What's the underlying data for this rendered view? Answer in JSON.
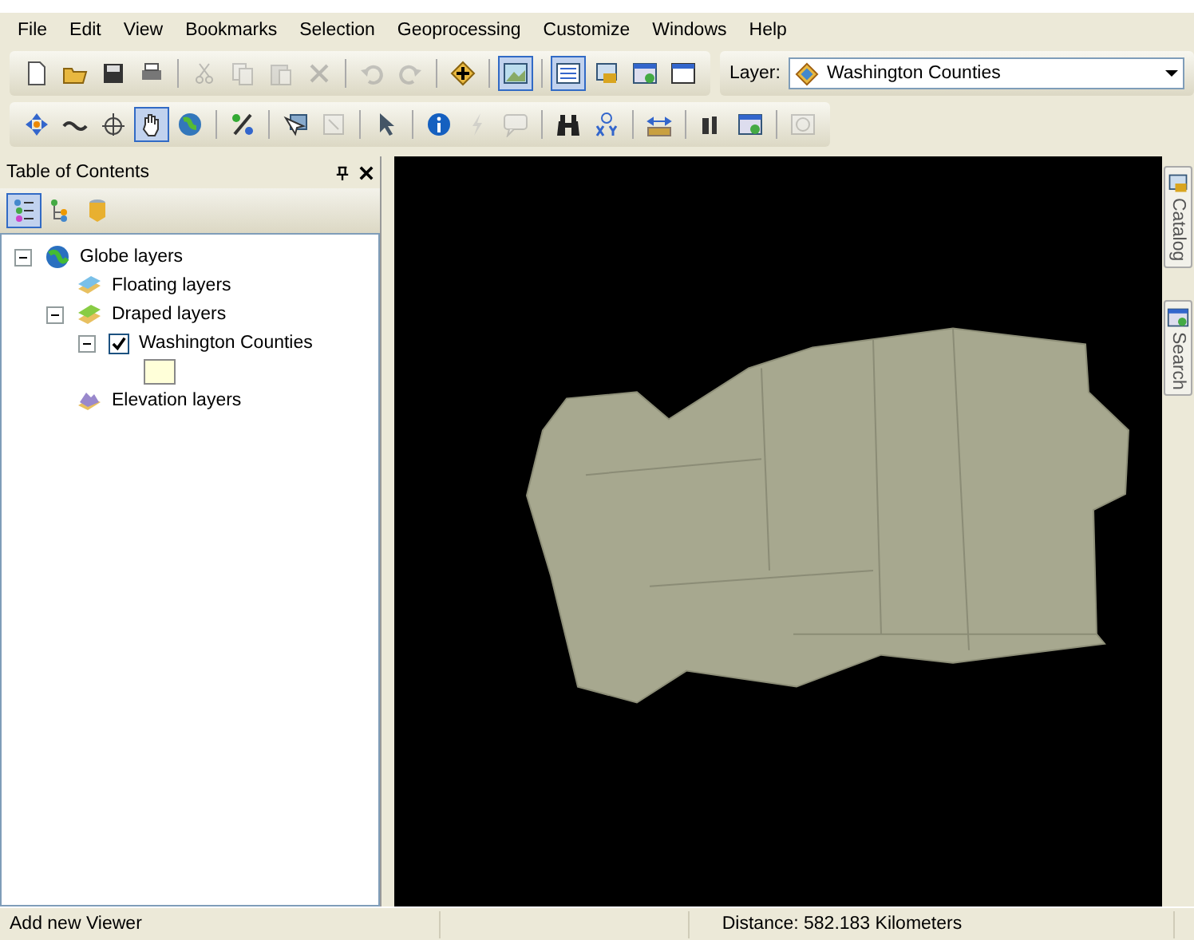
{
  "menu_bar": [
    "File",
    "Edit",
    "View",
    "Bookmarks",
    "Selection",
    "Geoprocessing",
    "Customize",
    "Windows",
    "Help"
  ],
  "toolbar_standard": [
    [
      {
        "kind": "new",
        "selected": false,
        "disabled": false
      },
      {
        "kind": "open",
        "selected": false,
        "disabled": false
      },
      {
        "kind": "save",
        "selected": false,
        "disabled": false
      },
      {
        "kind": "print",
        "selected": false,
        "disabled": false
      }
    ],
    [
      {
        "kind": "cut",
        "selected": false,
        "disabled": true
      },
      {
        "kind": "copy",
        "selected": false,
        "disabled": true
      },
      {
        "kind": "paste",
        "selected": false,
        "disabled": true
      },
      {
        "kind": "delete",
        "selected": false,
        "disabled": true
      }
    ],
    [
      {
        "kind": "undo",
        "selected": false,
        "disabled": true
      },
      {
        "kind": "redo",
        "selected": false,
        "disabled": true
      }
    ],
    [
      {
        "kind": "add",
        "selected": false,
        "disabled": false
      }
    ],
    [
      {
        "kind": "globe",
        "selected": true,
        "disabled": false
      }
    ],
    [
      {
        "kind": "list",
        "selected": true,
        "disabled": false
      },
      {
        "kind": "catalog",
        "selected": false,
        "disabled": false
      },
      {
        "kind": "window",
        "selected": false,
        "disabled": false
      },
      {
        "kind": "console",
        "selected": false,
        "disabled": false
      }
    ]
  ],
  "layer_selector": {
    "label": "Layer:",
    "value": "Washington Counties"
  },
  "toolbar_tools": [
    [
      {
        "kind": "navigate",
        "selected": false,
        "disabled": false
      },
      {
        "kind": "fly",
        "selected": false,
        "disabled": false
      },
      {
        "kind": "target",
        "selected": false,
        "disabled": false
      },
      {
        "kind": "pan",
        "selected": true,
        "disabled": false
      },
      {
        "kind": "earth",
        "selected": false,
        "disabled": false
      }
    ],
    [
      {
        "kind": "percent",
        "selected": false,
        "disabled": false
      }
    ],
    [
      {
        "kind": "select",
        "selected": false,
        "disabled": false
      },
      {
        "kind": "clear",
        "selected": false,
        "disabled": true
      }
    ],
    [
      {
        "kind": "pointer",
        "selected": false,
        "disabled": false
      }
    ],
    [
      {
        "kind": "info",
        "selected": false,
        "disabled": false
      },
      {
        "kind": "lightning",
        "selected": false,
        "disabled": true
      },
      {
        "kind": "popup",
        "selected": false,
        "disabled": true
      }
    ],
    [
      {
        "kind": "binoculars",
        "selected": false,
        "disabled": false
      },
      {
        "kind": "xy",
        "selected": false,
        "disabled": false
      }
    ],
    [
      {
        "kind": "ruler",
        "selected": false,
        "disabled": false
      }
    ],
    [
      {
        "kind": "flag",
        "selected": false,
        "disabled": false
      },
      {
        "kind": "window",
        "selected": false,
        "disabled": false
      }
    ],
    [
      {
        "kind": "clock",
        "selected": false,
        "disabled": true
      }
    ]
  ],
  "table_of_contents": {
    "title": "Table of Contents",
    "view_tabs": [
      {
        "kind": "layers",
        "selected": true
      },
      {
        "kind": "source",
        "selected": false
      },
      {
        "kind": "database",
        "selected": false
      }
    ],
    "tree": [
      {
        "label": "Globe layers",
        "kind": "globe",
        "expanded": true,
        "children": [
          {
            "label": "Floating layers",
            "kind": "floating"
          },
          {
            "label": "Draped layers",
            "kind": "draped",
            "expanded": true,
            "children": [
              {
                "label": "Washington Counties",
                "kind": "layer",
                "expanded": true,
                "checked": true,
                "color": "#ffffd9"
              }
            ]
          },
          {
            "label": "Elevation layers",
            "kind": "elevation"
          }
        ]
      }
    ]
  },
  "side_tabs": [
    "Catalog",
    "Search"
  ],
  "status_bar": {
    "message": "Add new Viewer",
    "distance": "Distance:  582.183 Kilometers"
  }
}
